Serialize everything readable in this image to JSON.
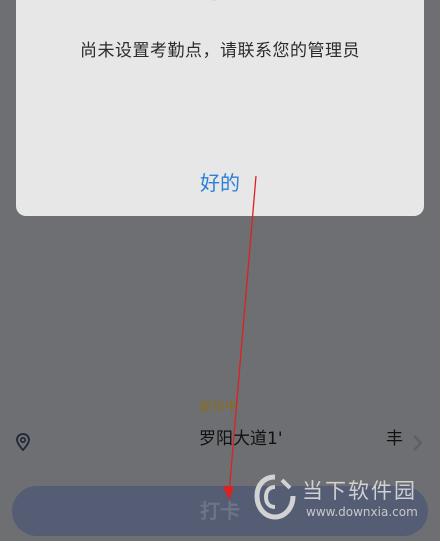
{
  "dialog": {
    "message": "尚未设置考勤点，请联系您的管理员",
    "ok_label": "好的",
    "top_mark": "”"
  },
  "location": {
    "status": "定位中",
    "address": "罗阳大道1'",
    "address_tail": "丰"
  },
  "punch_button": {
    "label": "打卡"
  },
  "watermark": {
    "title": "当下软件园",
    "url": "www.downxia.com"
  },
  "colors": {
    "overlay": "#6e6f72",
    "dialog_bg": "#e7e7e8",
    "ok_blue": "#2b7fd8",
    "status_gold": "#8a6d1a",
    "button_bg": "#545d74",
    "arrow_red": "#e02020"
  },
  "icons": {
    "location": "location-pin-icon",
    "chevron": "chevron-right-icon",
    "watermark_logo": "downxia-logo-icon"
  }
}
